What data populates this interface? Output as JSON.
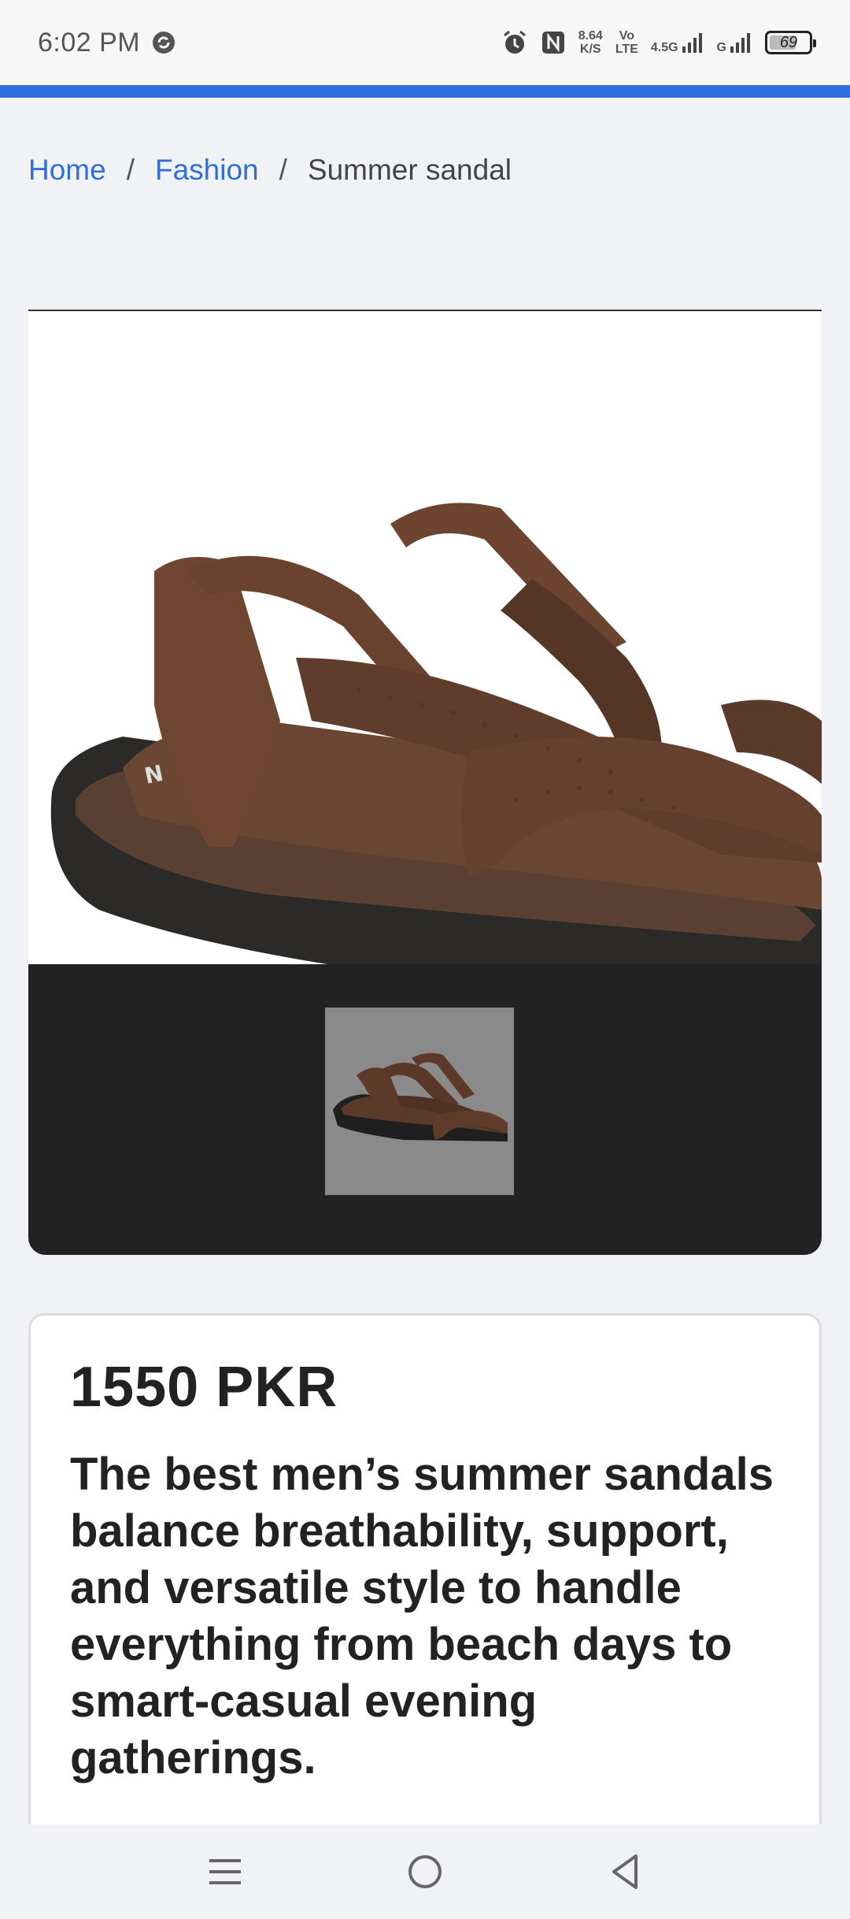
{
  "status_bar": {
    "time": "6:02 PM",
    "net_speed_value": "8.64",
    "net_speed_unit": "K/S",
    "volte_top": "Vo",
    "volte_bottom": "LTE",
    "net_type": "4.5G",
    "net_type2": "G",
    "battery": "69",
    "battery_level": 0.69
  },
  "theme": {
    "accent": "#2f6fe0",
    "link": "#2f6fd6",
    "gallery_bg": "#222222"
  },
  "breadcrumb": {
    "home": "Home",
    "category": "Fashion",
    "current": "Summer sandal",
    "separator": "/"
  },
  "product": {
    "price": "1550 PKR",
    "description": "The best men’s summer sandals balance breathability, support, and versatile style to handle everything from beach days to smart-casual evening gatherings."
  },
  "icons": {
    "sync": "sync-icon",
    "alarm": "alarm-icon",
    "nfc": "nfc-icon",
    "signal": "signal-icon",
    "menu": "menu-icon",
    "home": "home-icon",
    "back": "back-icon"
  }
}
